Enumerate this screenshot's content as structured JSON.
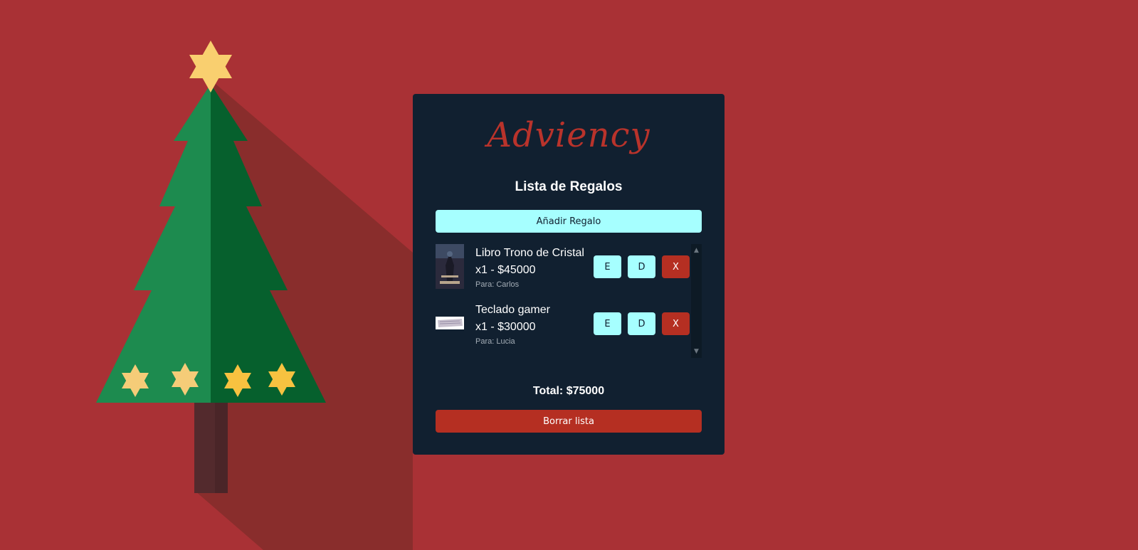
{
  "app": {
    "brand": "Adviency",
    "title": "Lista de Regalos"
  },
  "actions": {
    "add_label": "Añadir Regalo",
    "clear_label": "Borrar lista"
  },
  "gifts": [
    {
      "name": "Libro Trono de Cristal",
      "quantity_price": "x1 - $45000",
      "recipient": "Para: Carlos",
      "image_icon": "book-cover-thumbnail",
      "edit_label": "E",
      "duplicate_label": "D",
      "delete_label": "X"
    },
    {
      "name": "Teclado gamer",
      "quantity_price": "x1 - $30000",
      "recipient": "Para: Lucia",
      "image_icon": "keyboard-thumbnail",
      "edit_label": "E",
      "duplicate_label": "D",
      "delete_label": "X"
    }
  ],
  "summary": {
    "total": "Total: $75000"
  },
  "colors": {
    "background": "#a93135",
    "card": "#112030",
    "brand_text": "#b9332b",
    "primary_button": "#a6ffff",
    "danger_button": "#b52f22",
    "tree_light": "#1d8b4f",
    "tree_dark": "#06602d",
    "star": "#f9cf6f",
    "trunk": "#532a2d"
  }
}
